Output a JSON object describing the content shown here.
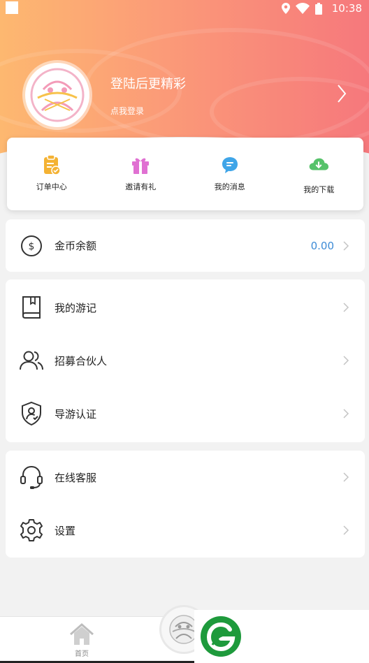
{
  "status_bar": {
    "time": "10:38"
  },
  "profile": {
    "title": "登陆后更精彩",
    "subtitle": "点我登录"
  },
  "quick_actions": [
    {
      "label": "订单中心",
      "icon": "order-clipboard-icon",
      "color": "#f4b233"
    },
    {
      "label": "邀请有礼",
      "icon": "gift-icon",
      "color": "#e070d2"
    },
    {
      "label": "我的消息",
      "icon": "message-bubble-icon",
      "color": "#3fa5e8"
    },
    {
      "label": "我的下载",
      "icon": "cloud-download-icon",
      "color": "#56c26a"
    }
  ],
  "wallet": {
    "label": "金币余额",
    "value": "0.00"
  },
  "menu_group_1": [
    {
      "label": "我的游记",
      "icon": "book-icon"
    },
    {
      "label": "招募合伙人",
      "icon": "users-icon"
    },
    {
      "label": "导游认证",
      "icon": "shield-user-icon"
    }
  ],
  "menu_group_2": [
    {
      "label": "在线客服",
      "icon": "headset-icon"
    },
    {
      "label": "设置",
      "icon": "gear-icon"
    }
  ],
  "tabbar": {
    "home_label": "首页"
  },
  "colors": {
    "accent_value": "#3d8bd6",
    "header_start": "#fdb870",
    "header_end": "#f6787c",
    "brand_green": "#1e9a3c"
  }
}
